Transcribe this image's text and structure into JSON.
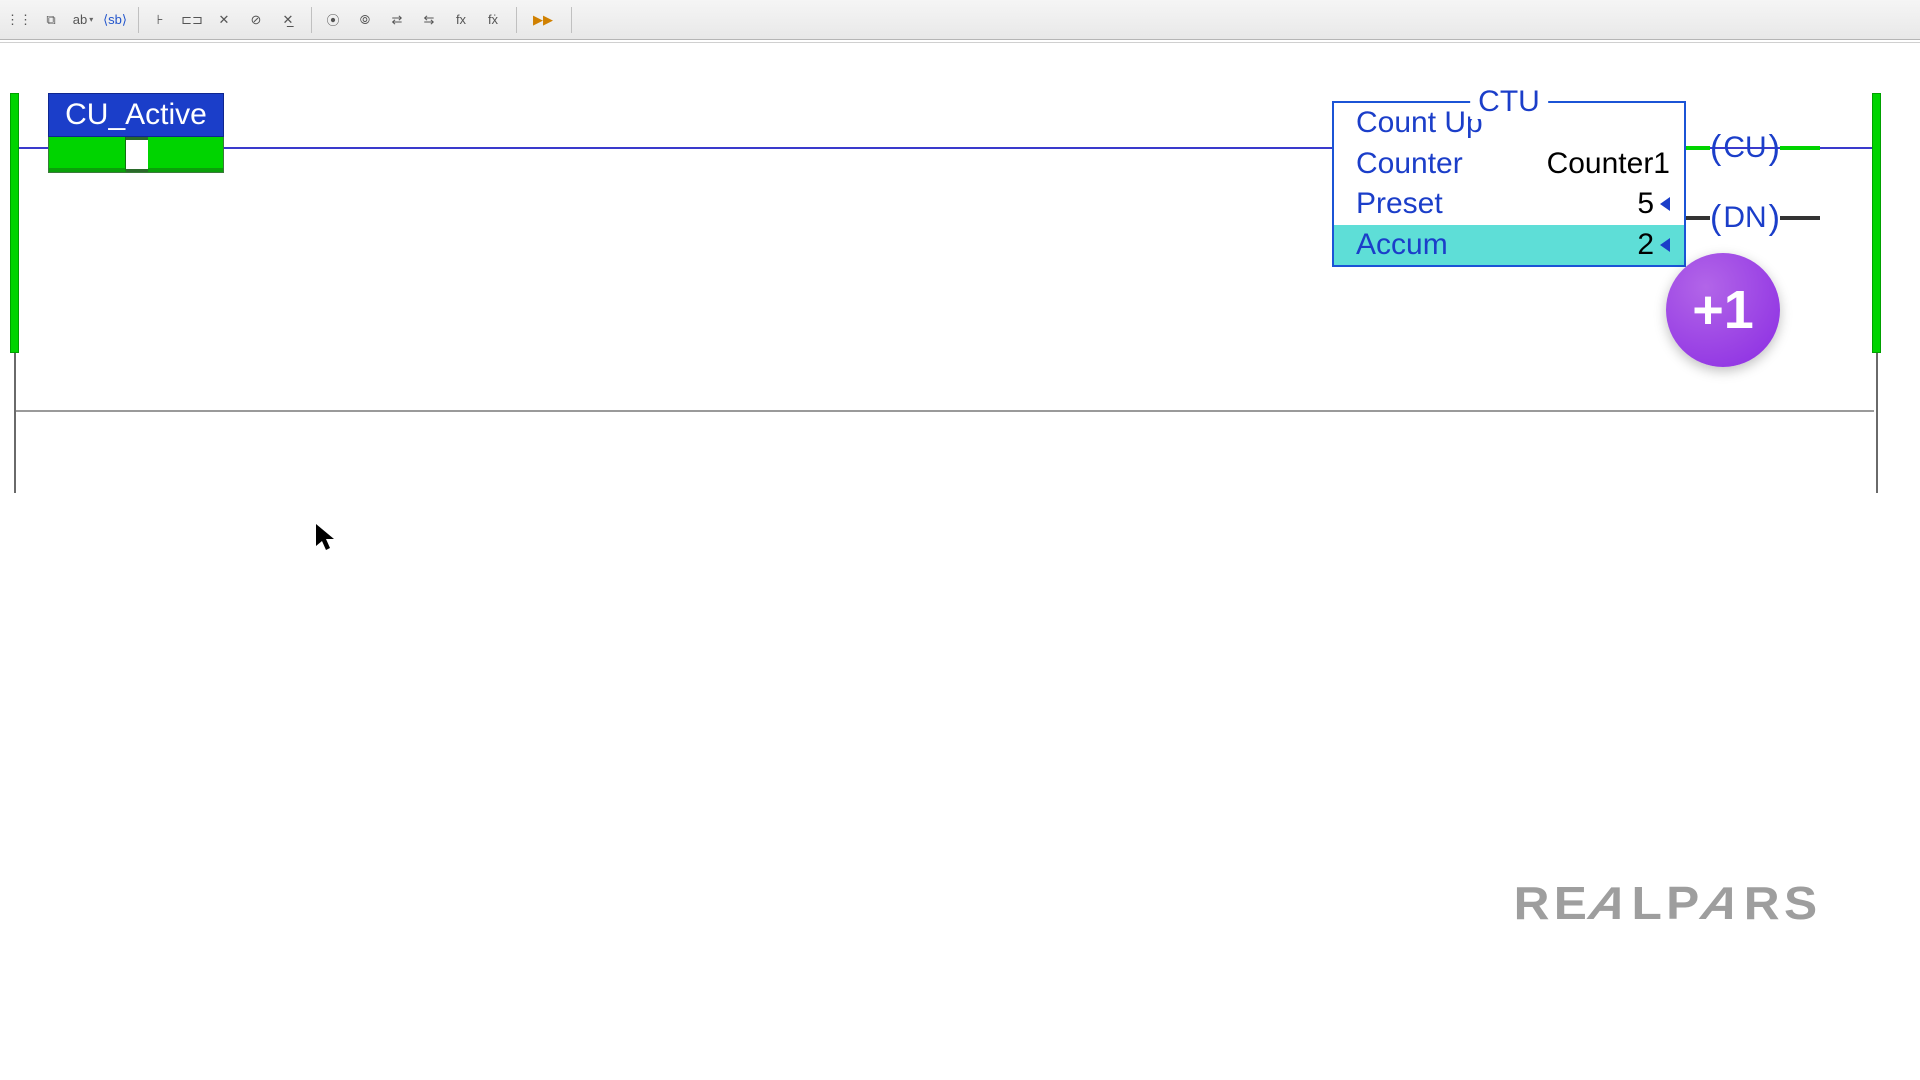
{
  "toolbar": {
    "buttons": [
      "cd",
      "rd",
      "ab",
      "drop",
      "sb",
      "rung",
      "branch",
      "xio",
      "ote",
      "otl",
      "coil1",
      "coil2",
      "mov1",
      "mov2",
      "fx1",
      "fx2",
      "run"
    ]
  },
  "contact": {
    "label": "CU_Active"
  },
  "ctu": {
    "title": "CTU",
    "desc": "Count Up",
    "counter_k": "Counter",
    "counter_v": "Counter1",
    "preset_k": "Preset",
    "preset_v": "5",
    "accum_k": "Accum",
    "accum_v": "2"
  },
  "coils": {
    "cu": "CU",
    "dn": "DN"
  },
  "badge": "+1",
  "watermark": "REALPARS"
}
